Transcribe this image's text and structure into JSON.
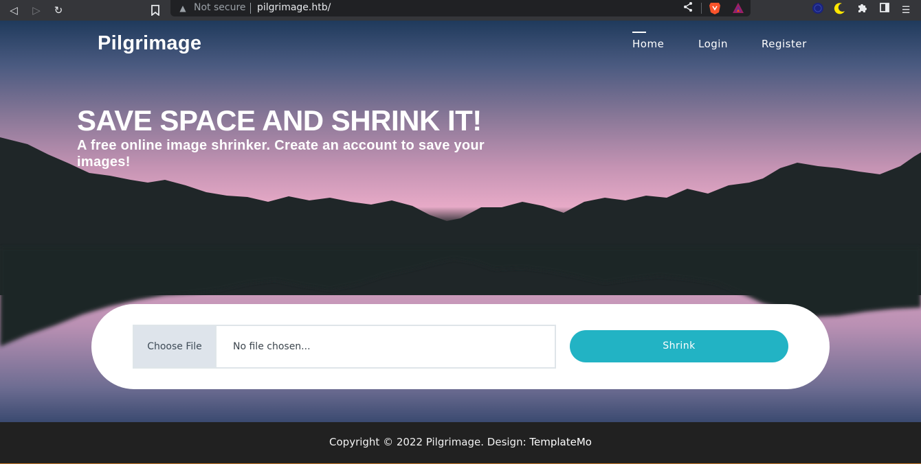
{
  "browser": {
    "security_label": "Not secure",
    "url": "pilgrimage.htb/",
    "icons": [
      "back-icon",
      "forward-icon",
      "reload-icon",
      "bookmark-icon",
      "warning-icon",
      "share-icon",
      "brave-shields-icon",
      "brave-rewards-icon",
      "vpn-extension-icon",
      "dark-mode-icon",
      "extensions-icon",
      "sidebar-icon",
      "menu-icon"
    ]
  },
  "site": {
    "logo": "Pilgrimage",
    "nav": {
      "home": "Home",
      "login": "Login",
      "register": "Register"
    },
    "hero": {
      "title": "SAVE SPACE AND SHRINK IT!",
      "subtitle": "A free online image shrinker. Create an account to save your images!"
    },
    "upload": {
      "choose_label": "Choose File",
      "file_status": "No file chosen...",
      "submit_label": "Shrink"
    },
    "footer": {
      "copyright": "Copyright © 2022 Pilgrimage. Design: ",
      "credit": "TemplateMo"
    }
  },
  "colors": {
    "accent": "#22b3c4",
    "footer_bg": "#212121",
    "mountain": "#1f2628",
    "sky_pink": "#e7aac7"
  }
}
